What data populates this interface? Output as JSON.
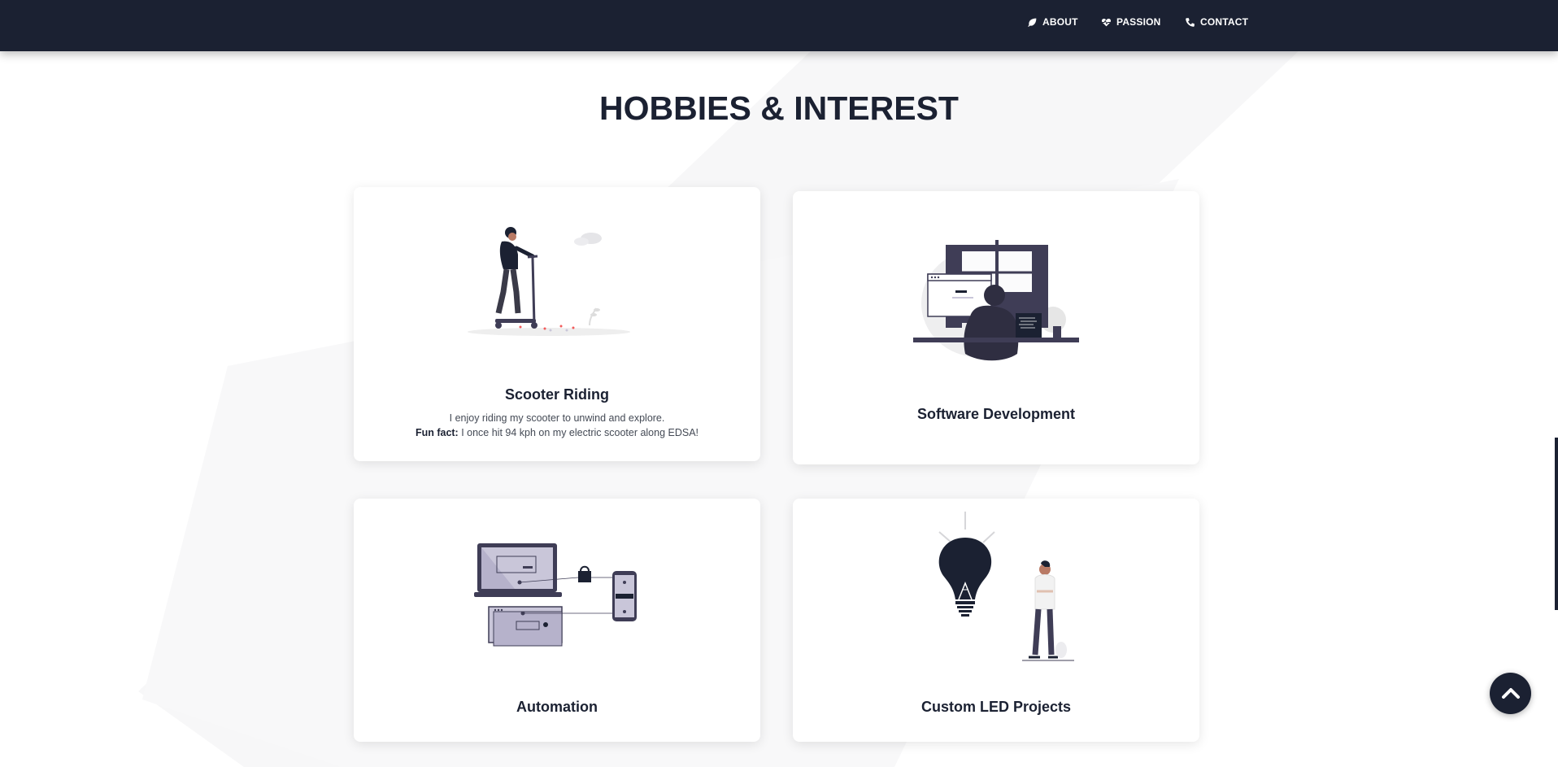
{
  "nav": {
    "items": [
      {
        "label": "ABOUT",
        "icon": "leaf-icon"
      },
      {
        "label": "PASSION",
        "icon": "heart-pulse-icon"
      },
      {
        "label": "CONTACT",
        "icon": "phone-icon"
      }
    ]
  },
  "section": {
    "title": "HOBBIES & INTEREST"
  },
  "cards": [
    {
      "title": "Scooter Riding",
      "description": "I enjoy riding my scooter to unwind and explore.",
      "fun_fact_label": "Fun fact:",
      "fun_fact_text": " I once hit 94 kph on my electric scooter along EDSA!",
      "icon": "scooter-rider-illustration"
    },
    {
      "title": "Software Development",
      "icon": "developer-desk-illustration"
    },
    {
      "title": "Automation",
      "icon": "connected-devices-illustration"
    },
    {
      "title": "Custom LED Projects",
      "icon": "lightbulb-person-illustration"
    }
  ],
  "colors": {
    "navy": "#1b2132",
    "lavender": "#c9c6d9",
    "accent_red": "#f25a5a"
  },
  "scroll_top": {
    "icon": "chevron-up-icon"
  }
}
